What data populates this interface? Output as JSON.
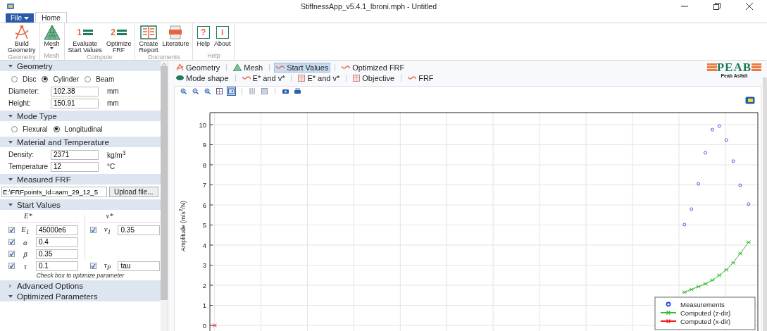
{
  "window": {
    "title": "StiffnessApp_v5.4.1_lbroni.mph - Untitled"
  },
  "menu_tabs": [
    {
      "label": "File",
      "kind": "file",
      "selected": false
    },
    {
      "label": "Home",
      "kind": "tab",
      "selected": true
    }
  ],
  "ribbon": {
    "groups": [
      {
        "label": "Geometry",
        "buttons": [
          {
            "label": "Build\nGeometry",
            "kind": "geometry",
            "dropdown": false
          }
        ]
      },
      {
        "label": "Mesh",
        "buttons": [
          {
            "label": "Mesh",
            "kind": "mesh",
            "dropdown": true
          }
        ]
      },
      {
        "label": "Compute",
        "buttons": [
          {
            "label": "Evaluate\nStart Values",
            "kind": "step",
            "icon_text": "1",
            "dropdown": false
          },
          {
            "label": "Optimize\nFRF",
            "kind": "step",
            "icon_text": "2",
            "dropdown": false
          }
        ]
      },
      {
        "label": "Documents",
        "buttons": [
          {
            "label": "Create\nReport",
            "kind": "report",
            "dropdown": false
          },
          {
            "label": "Literature",
            "kind": "pdf",
            "dropdown": false
          }
        ]
      },
      {
        "label": "Help",
        "buttons": [
          {
            "label": "Help",
            "kind": "sign",
            "icon_text": "?",
            "dropdown": false
          },
          {
            "label": "About",
            "kind": "sign",
            "icon_text": "i",
            "dropdown": false
          }
        ]
      }
    ]
  },
  "sidebar": {
    "sections": [
      {
        "title": "Geometry",
        "expanded": true,
        "rows": [
          {
            "kind": "radios",
            "options": [
              {
                "label": "Disc",
                "selected": false
              },
              {
                "label": "Cylinder",
                "selected": true
              },
              {
                "label": "Beam",
                "selected": false
              }
            ]
          },
          {
            "kind": "field",
            "label": "Diameter:",
            "value": "102.38",
            "unit": "mm"
          },
          {
            "kind": "field",
            "label": "Height:",
            "value": "150.91",
            "unit": "mm"
          }
        ]
      },
      {
        "title": "Mode Type",
        "expanded": true,
        "rows": [
          {
            "kind": "radios",
            "options": [
              {
                "label": "Flexural",
                "selected": false
              },
              {
                "label": "Longitudinal",
                "selected": true
              }
            ]
          }
        ]
      },
      {
        "title": "Material and Temperature",
        "expanded": true,
        "rows": [
          {
            "kind": "field",
            "label": "Density:",
            "value": "2371",
            "unit": "kg/m$^{3}$"
          },
          {
            "kind": "field",
            "label": "Temperature",
            "value": "12",
            "unit": "°C"
          }
        ]
      },
      {
        "title": "Measured FRF",
        "expanded": true,
        "rows": [
          {
            "kind": "file",
            "value": "E:\\FRFpoints_Id=aam_29_12_5",
            "button": "Upload file..."
          }
        ]
      },
      {
        "title": "Start Values",
        "expanded": true,
        "rows": [
          {
            "kind": "params",
            "columns": [
              "E*",
              "ν*"
            ],
            "rows": [
              {
                "left": {
                  "symbol": "E$_{1}$",
                  "value": "45000e6",
                  "checked": true
                },
                "right": {
                  "symbol": "ν$_{1}$",
                  "value": "0.35",
                  "checked": true
                }
              },
              {
                "left": {
                  "symbol": "α",
                  "value": "0.4",
                  "checked": true
                }
              },
              {
                "left": {
                  "symbol": "β",
                  "value": "0.35",
                  "checked": true
                }
              },
              {
                "left": {
                  "symbol": "τ",
                  "value": "0.1",
                  "checked": true
                },
                "right": {
                  "symbol": "τ$_{P}$",
                  "value": "tau",
                  "checked": true
                }
              }
            ]
          },
          {
            "kind": "note",
            "text": "Check box to optimize parameter"
          }
        ]
      },
      {
        "title": "Advanced Options",
        "expanded": false
      },
      {
        "title": "Optimized Parameters",
        "expanded": true
      }
    ]
  },
  "graph_tabs": [
    [
      {
        "label": "Geometry",
        "kind": "geometry",
        "selected": false
      },
      {
        "label": "Mesh",
        "kind": "mesh",
        "selected": false
      },
      {
        "label": "Start Values",
        "kind": "curve",
        "selected": true
      },
      {
        "label": "Optimized FRF",
        "kind": "curve",
        "selected": false
      }
    ],
    [
      {
        "label": "Mode shape",
        "kind": "ellipse",
        "selected": false
      },
      {
        "label": "E* and v*",
        "kind": "curve",
        "selected": false
      },
      {
        "label": "E* and v*",
        "kind": "table",
        "selected": false
      },
      {
        "label": "Objective",
        "kind": "table",
        "selected": false
      },
      {
        "label": "FRF",
        "kind": "curve",
        "selected": false
      }
    ]
  ],
  "plot_toolbar": [
    {
      "kind": "zoom-in",
      "selected": false
    },
    {
      "kind": "zoom-out",
      "selected": false
    },
    {
      "kind": "zoom-box",
      "selected": false
    },
    {
      "kind": "zoom-extents",
      "selected": false
    },
    {
      "kind": "toggle",
      "selected": true
    },
    {
      "kind": "sep"
    },
    {
      "kind": "grid",
      "selected": false
    },
    {
      "kind": "table",
      "selected": false
    },
    {
      "kind": "sep"
    },
    {
      "kind": "camera",
      "selected": false
    },
    {
      "kind": "print",
      "selected": false
    }
  ],
  "logo": {
    "name": "PEAB",
    "subtitle": "Peab Asfalt"
  },
  "chart": {
    "ylabel": "Amplitude (m/s$^{2}$/N)",
    "yticks": [
      "10",
      "9",
      "8",
      "7",
      "6",
      "5",
      "4",
      "3",
      "2",
      "1",
      "0"
    ],
    "legend": [
      {
        "name": "Measurements",
        "color": "#3344ee",
        "kind": "circle"
      },
      {
        "name": "Computed (z-dir)",
        "color": "#33bb33",
        "kind": "star"
      },
      {
        "name": "Computed (x-dir)",
        "color": "#ee2222",
        "kind": "star"
      }
    ]
  }
}
